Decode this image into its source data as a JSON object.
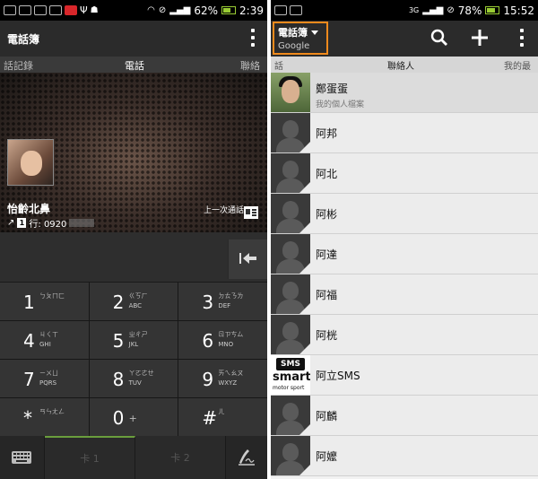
{
  "left": {
    "statusbar": {
      "battery": "62%",
      "time": "2:39"
    },
    "actionbar": {
      "title": "電話簿"
    },
    "tabs": [
      "話記錄",
      "電話",
      "聯絡"
    ],
    "caller": {
      "name": "怡齡北鼻",
      "sim": "1",
      "number_prefix": "行: 0920",
      "last_call": "上一次通話"
    },
    "keypad": [
      {
        "digit": "1",
        "zh": "ㄅㄆㄇㄈ",
        "en": ""
      },
      {
        "digit": "2",
        "zh": "ㄍㄎㄏ",
        "en": "ABC"
      },
      {
        "digit": "3",
        "zh": "ㄉㄊㄋㄌ",
        "en": "DEF"
      },
      {
        "digit": "4",
        "zh": "ㄐㄑㄒ",
        "en": "GHI"
      },
      {
        "digit": "5",
        "zh": "ㄓㄔㄕ",
        "en": "JKL"
      },
      {
        "digit": "6",
        "zh": "ㄖㄗㄘㄙ",
        "en": "MNO"
      },
      {
        "digit": "7",
        "zh": "ㄧㄨㄩ",
        "en": "PQRS"
      },
      {
        "digit": "8",
        "zh": "ㄚㄛㄜㄝ",
        "en": "TUV"
      },
      {
        "digit": "9",
        "zh": "ㄞㄟㄠㄡ",
        "en": "WXYZ"
      },
      {
        "digit": "*",
        "zh": "ㄢㄣㄤㄥ",
        "en": ""
      },
      {
        "digit": "0",
        "zh": "+",
        "en": ""
      },
      {
        "digit": "#",
        "zh": "ㄦ",
        "en": ""
      }
    ],
    "bottom": {
      "sim1": "卡 1",
      "sim2": "卡 2"
    }
  },
  "right": {
    "statusbar": {
      "battery": "78%",
      "time": "15:52"
    },
    "account": {
      "title": "電話簿",
      "subtitle": "Google"
    },
    "tabs": [
      "話",
      "聯絡人",
      "我的最"
    ],
    "contacts": [
      {
        "name": "鄭蛋蛋",
        "sub": "我的個人檔案",
        "avatar": "photo"
      },
      {
        "name": "阿邦",
        "avatar": "default"
      },
      {
        "name": "阿北",
        "avatar": "default"
      },
      {
        "name": "阿彬",
        "avatar": "default"
      },
      {
        "name": "阿達",
        "avatar": "default"
      },
      {
        "name": "阿福",
        "avatar": "default"
      },
      {
        "name": "阿桄",
        "avatar": "default"
      },
      {
        "name": "阿立SMS",
        "avatar": "sms"
      },
      {
        "name": "阿麟",
        "avatar": "default"
      },
      {
        "name": "阿嬤",
        "avatar": "default"
      }
    ],
    "sms_logo": {
      "top": "SMS",
      "big": "smart",
      "small": "motor sport"
    }
  },
  "colors": {
    "highlight_border": "#f08a1c",
    "active_sim_tab": "#6a9e3c"
  }
}
